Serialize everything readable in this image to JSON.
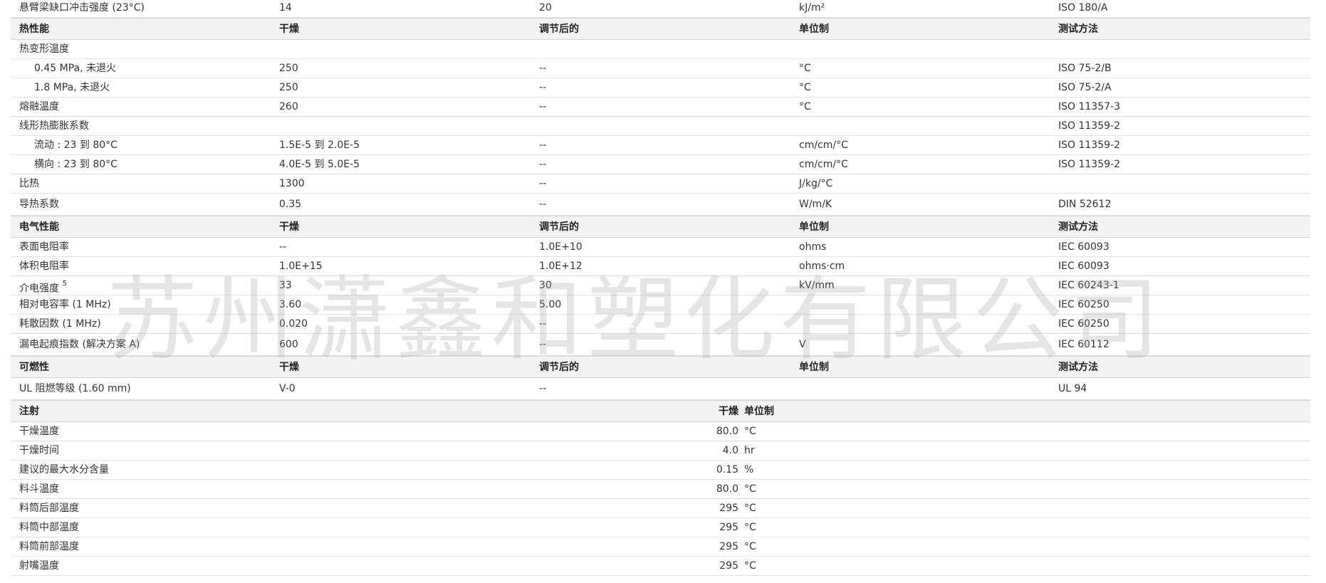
{
  "watermark": "苏州潇鑫和塑化有限公司",
  "top_row": [
    "悬臂梁缺口冲击强度 (23°C)",
    "14",
    "20",
    "kJ/m²",
    "ISO 180/A"
  ],
  "thermal": {
    "header": [
      "热性能",
      "干燥",
      "调节后的",
      "单位制",
      "测试方法"
    ],
    "rows": [
      {
        "name": "热变形温度",
        "dry": "",
        "cond": "",
        "unit": "",
        "method": ""
      },
      {
        "name": "0.45 MPa, 未退火",
        "dry": "250",
        "cond": "--",
        "unit": "°C",
        "method": "ISO 75-2/B"
      },
      {
        "name": "1.8 MPa, 未退火",
        "dry": "250",
        "cond": "--",
        "unit": "°C",
        "method": "ISO 75-2/A"
      },
      {
        "name": "熔融温度",
        "dry": "260",
        "cond": "--",
        "unit": "°C",
        "method": "ISO 11357-3"
      },
      {
        "name": "线形热膨胀系数",
        "dry": "",
        "cond": "",
        "unit": "",
        "method": "ISO 11359-2"
      },
      {
        "name": "流动 : 23 到 80°C",
        "dry": "1.5E-5 到 2.0E-5",
        "cond": "--",
        "unit": "cm/cm/°C",
        "method": "ISO 11359-2"
      },
      {
        "name": "横向 : 23 到 80°C",
        "dry": "4.0E-5 到 5.0E-5",
        "cond": "--",
        "unit": "cm/cm/°C",
        "method": "ISO 11359-2"
      },
      {
        "name": "比热",
        "dry": "1300",
        "cond": "--",
        "unit": "J/kg/°C",
        "method": ""
      },
      {
        "name": "导热系数",
        "dry": "0.35",
        "cond": "--",
        "unit": "W/m/K",
        "method": "DIN 52612"
      }
    ]
  },
  "electrical": {
    "header": [
      "电气性能",
      "干燥",
      "调节后的",
      "单位制",
      "测试方法"
    ],
    "rows": [
      {
        "name": "表面电阻率",
        "dry": "--",
        "cond": "1.0E+10",
        "unit": "ohms",
        "method": "IEC 60093"
      },
      {
        "name": "体积电阻率",
        "dry": "1.0E+15",
        "cond": "1.0E+12",
        "unit": "ohms·cm",
        "method": "IEC 60093"
      },
      {
        "name": "介电强度",
        "sup": "5",
        "dry": "33",
        "cond": "30",
        "unit": "kV/mm",
        "method": "IEC 60243-1"
      },
      {
        "name": "相对电容率 (1 MHz)",
        "dry": "3.60",
        "cond": "5.00",
        "unit": "",
        "method": "IEC 60250"
      },
      {
        "name": "耗散因数 (1 MHz)",
        "dry": "0.020",
        "cond": "--",
        "unit": "",
        "method": "IEC 60250"
      },
      {
        "name": "漏电起痕指数 (解决方案 A)",
        "dry": "600",
        "cond": "--",
        "unit": "V",
        "method": "IEC 60112"
      }
    ]
  },
  "flammability": {
    "header": [
      "可燃性",
      "干燥",
      "调节后的",
      "单位制",
      "测试方法"
    ],
    "rows": [
      {
        "name": "UL 阻燃等级 (1.60 mm)",
        "dry": "V-0",
        "cond": "--",
        "unit": "",
        "method": "UL 94"
      }
    ]
  },
  "injection": {
    "header": [
      "注射",
      "干燥",
      "单位制"
    ],
    "rows": [
      {
        "name": "干燥温度",
        "value": "80.0",
        "unit": "°C"
      },
      {
        "name": "干燥时间",
        "value": "4.0",
        "unit": "hr"
      },
      {
        "name": "建议的最大水分含量",
        "value": "0.15",
        "unit": "%"
      },
      {
        "name": "料斗温度",
        "value": "80.0",
        "unit": "°C"
      },
      {
        "name": "料筒后部温度",
        "value": "295",
        "unit": "°C"
      },
      {
        "name": "料筒中部温度",
        "value": "295",
        "unit": "°C"
      },
      {
        "name": "料筒前部温度",
        "value": "295",
        "unit": "°C"
      },
      {
        "name": "射嘴温度",
        "value": "295",
        "unit": "°C"
      }
    ]
  }
}
